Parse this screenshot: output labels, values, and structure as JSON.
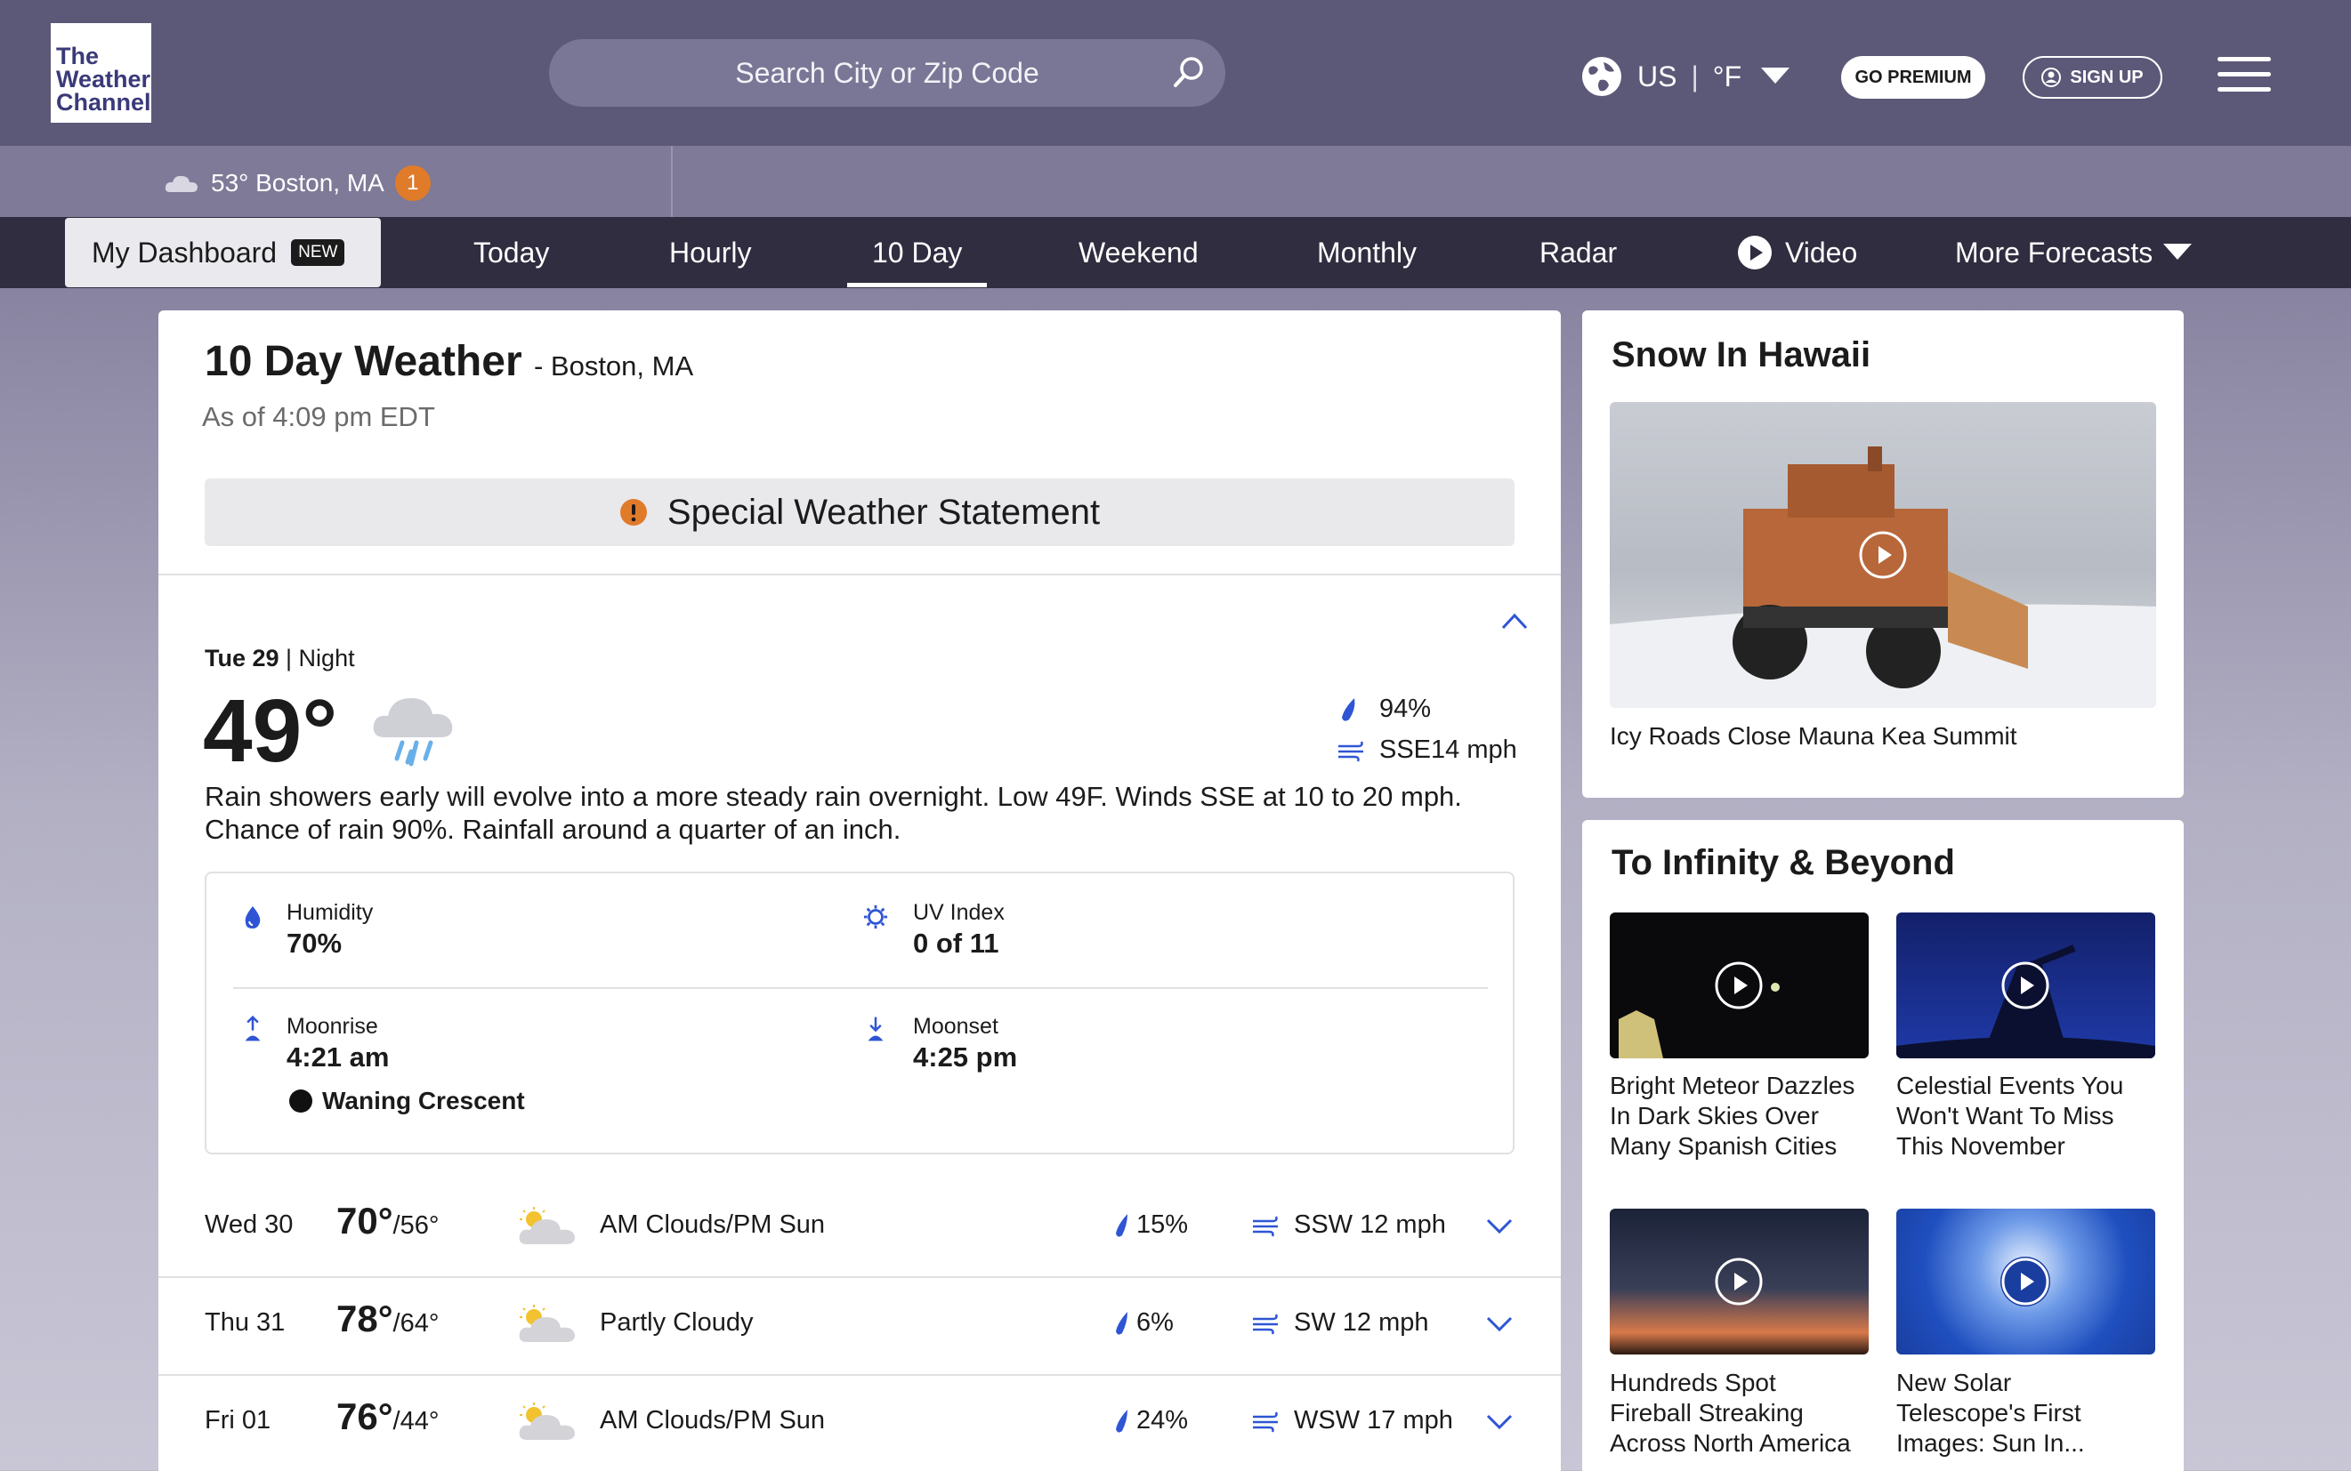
{
  "header": {
    "logo_lines": [
      "The",
      "Weather",
      "Channel"
    ],
    "search_placeholder": "Search City or Zip Code",
    "region": "US",
    "unit": "°F",
    "premium_label": "GO PREMIUM",
    "signup_label": "SIGN UP"
  },
  "recent_location": {
    "temp": "53°",
    "place": "Boston, MA",
    "badge": "1"
  },
  "nav": {
    "dashboard": "My Dashboard",
    "new_badge": "NEW",
    "items": [
      "Today",
      "Hourly",
      "10 Day",
      "Weekend",
      "Monthly",
      "Radar",
      "Video",
      "More Forecasts"
    ],
    "active": "10 Day"
  },
  "main": {
    "title": "10 Day Weather",
    "location": "- Boston, MA",
    "as_of": "As of 4:09 pm EDT",
    "alert": "Special Weather Statement",
    "current": {
      "day": "Tue 29",
      "period": "| Night",
      "temp": "49°",
      "precip": "94%",
      "wind": "SSE14 mph",
      "narrative": "Rain showers early will evolve into a more steady rain overnight. Low 49F. Winds SSE at 10 to 20 mph. Chance of rain 90%. Rainfall around a quarter of an inch.",
      "humidity_label": "Humidity",
      "humidity": "70%",
      "uv_label": "UV Index",
      "uv": "0 of 11",
      "moonrise_label": "Moonrise",
      "moonrise": "4:21 am",
      "moonset_label": "Moonset",
      "moonset": "4:25 pm",
      "moon_phase": "Waning Crescent"
    },
    "days": [
      {
        "day": "Wed 30",
        "high": "70°",
        "low": "/56°",
        "cond": "AM Clouds/PM Sun",
        "precip": "15%",
        "wind": "SSW 12 mph",
        "icon": "partly-cloudy-icon"
      },
      {
        "day": "Thu 31",
        "high": "78°",
        "low": "/64°",
        "cond": "Partly Cloudy",
        "precip": "6%",
        "wind": "SW 12 mph",
        "icon": "partly-cloudy-icon"
      },
      {
        "day": "Fri 01",
        "high": "76°",
        "low": "/44°",
        "cond": "AM Clouds/PM Sun",
        "precip": "24%",
        "wind": "WSW 17 mph",
        "icon": "partly-cloudy-icon"
      }
    ]
  },
  "side": {
    "card1_title": "Snow In Hawaii",
    "card1_caption": "Icy Roads Close Mauna Kea Summit",
    "card2_title": "To Infinity & Beyond",
    "videos": [
      {
        "lines": [
          "Bright Meteor Dazzles",
          "In Dark Skies Over",
          "Many Spanish Cities"
        ]
      },
      {
        "lines": [
          "Celestial Events You",
          "Won't Want To Miss",
          "This November"
        ]
      },
      {
        "lines": [
          "Hundreds Spot",
          "Fireball Streaking",
          "Across North America"
        ]
      },
      {
        "lines": [
          "New Solar",
          "Telescope's First",
          "Images: Sun In..."
        ]
      }
    ]
  },
  "colors": {
    "header": "#5c5878",
    "nav": "#2f2d3f",
    "accent_blue": "#2f55d4",
    "alert_orange": "#e07b2a"
  }
}
